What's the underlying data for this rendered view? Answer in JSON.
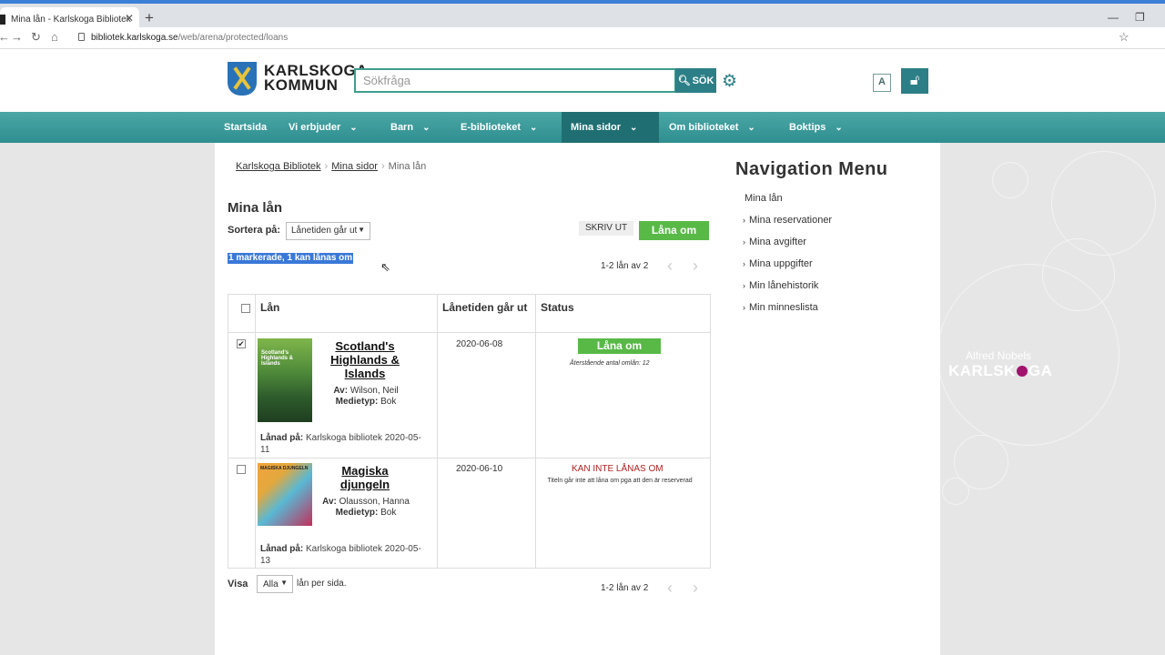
{
  "browser": {
    "tab_title": "Mina lån - Karlskoga Bibliotek",
    "url_domain": "bibliotek.karlskoga.se",
    "url_path": "/web/arena/protected/loans"
  },
  "header": {
    "logo_line1": "KARLSKOGA",
    "logo_line2": "KOMMUN",
    "search_placeholder": "Sökfråga",
    "search_button": "SÖK"
  },
  "nav": {
    "items": [
      {
        "label": "Startsida",
        "has_menu": false
      },
      {
        "label": "Vi erbjuder",
        "has_menu": true
      },
      {
        "label": "Barn",
        "has_menu": true
      },
      {
        "label": "E-biblioteket",
        "has_menu": true
      },
      {
        "label": "Mina sidor",
        "has_menu": true,
        "active": true
      },
      {
        "label": "Om biblioteket",
        "has_menu": true
      },
      {
        "label": "Boktips",
        "has_menu": true
      }
    ]
  },
  "breadcrumb": [
    "Karlskoga Bibliotek",
    "Mina sidor",
    "Mina lån"
  ],
  "page_title": "Mina lån",
  "sort": {
    "label": "Sortera på:",
    "selected": "Lånetiden går ut"
  },
  "actions": {
    "print": "SKRIV UT",
    "renew": "Låna om"
  },
  "selection_info": "1 markerade, 1 kan lånas om",
  "pager": {
    "text": "1-2 lån av 2"
  },
  "table": {
    "headers": [
      "Lån",
      "Lånetiden går ut",
      "Status"
    ],
    "rows": [
      {
        "checked": true,
        "title": "Scotland's Highlands & Islands",
        "cover_text": "Scotland's Highlands & Islands",
        "author_label": "Av:",
        "author": "Wilson, Neil",
        "media_label": "Medietyp:",
        "media": "Bok",
        "loaned_label": "Lånad på:",
        "loaned_at": "Karlskoga bibliotek 2020-05-11",
        "due": "2020-06-08",
        "status_button": "Låna om",
        "status_note": "Återstående antal omlån: 12"
      },
      {
        "checked": false,
        "title": "Magiska djungeln",
        "cover_text": "MAGISKA DJUNGELN",
        "author_label": "Av:",
        "author": "Olausson, Hanna",
        "media_label": "Medietyp:",
        "media": "Bok",
        "loaned_label": "Lånad på:",
        "loaned_at": "Karlskoga bibliotek 2020-05-13",
        "due": "2020-06-10",
        "status_text": "KAN INTE LÅNAS OM",
        "status_note": "Titeln går inte att låna om pga att den är reserverad"
      }
    ]
  },
  "footer_pager": {
    "label": "Visa",
    "selected": "Alla",
    "suffix": "lån per sida."
  },
  "side_menu": {
    "title": "Navigation Menu",
    "items": [
      "Mina lån",
      "Mina reservationer",
      "Mina avgifter",
      "Mina uppgifter",
      "Min lånehistorik",
      "Min minneslista"
    ]
  },
  "brand": {
    "small": "Alfred Nobels",
    "big_part1": "KARLSK",
    "big_part2": "GA"
  },
  "colors": {
    "accent": "#2d7f87",
    "nav": "#3a9a9a",
    "renew": "#58b947",
    "brand_dot": "#a1136d",
    "error": "#b02222"
  }
}
